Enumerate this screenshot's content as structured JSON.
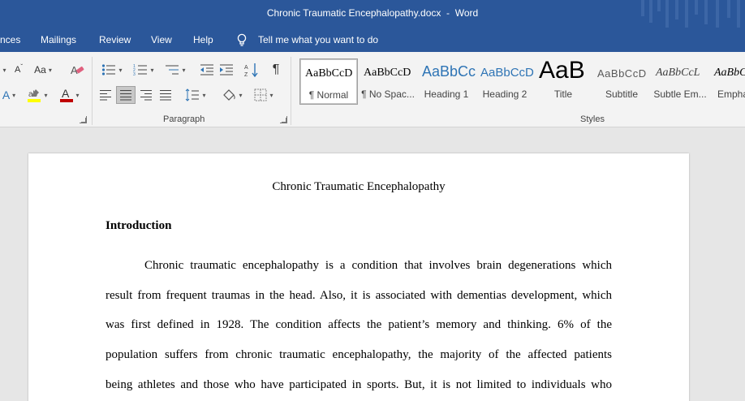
{
  "window": {
    "title": "Chronic Traumatic Encephalopathy.docx  -  Word"
  },
  "ribbon_tabs": [
    "nces",
    "Mailings",
    "Review",
    "View",
    "Help"
  ],
  "tell_me": "Tell me what you want to do",
  "ribbon": {
    "font_grow_label": "A",
    "change_case_label": "Aa",
    "paragraph_group_label": "Paragraph",
    "styles_group_label": "Styles",
    "show_marks_glyph": "¶"
  },
  "styles": [
    {
      "sample": "AaBbCcD",
      "name": "¶ Normal"
    },
    {
      "sample": "AaBbCcD",
      "name": "¶ No Spac..."
    },
    {
      "sample": "AaBbCc",
      "name": "Heading 1"
    },
    {
      "sample": "AaBbCcD",
      "name": "Heading 2"
    },
    {
      "sample": "AaB",
      "name": "Title"
    },
    {
      "sample": "AaBbCcD",
      "name": "Subtitle"
    },
    {
      "sample": "AaBbCcL",
      "name": "Subtle Em..."
    },
    {
      "sample": "AaBbCcL",
      "name": "Empha"
    }
  ],
  "document": {
    "title": "Chronic Traumatic Encephalopathy",
    "heading": "Introduction",
    "lines": [
      "Chronic traumatic encephalopathy is a condition that involves brain degenerations which",
      "result from frequent traumas in the head. Also, it is associated with dementias development, which",
      "was first defined in 1928. The condition affects the patient’s memory and thinking. 6% of the",
      "population suffers from chronic traumatic encephalopathy, the majority of the affected patients",
      "being athletes and those who have participated in sports. But, it is not limited to individuals who"
    ]
  },
  "colors": {
    "accent": "#2b579a",
    "heading_style": "#2e74b5",
    "highlight": "#ffff00",
    "font_color": "#c00000"
  }
}
